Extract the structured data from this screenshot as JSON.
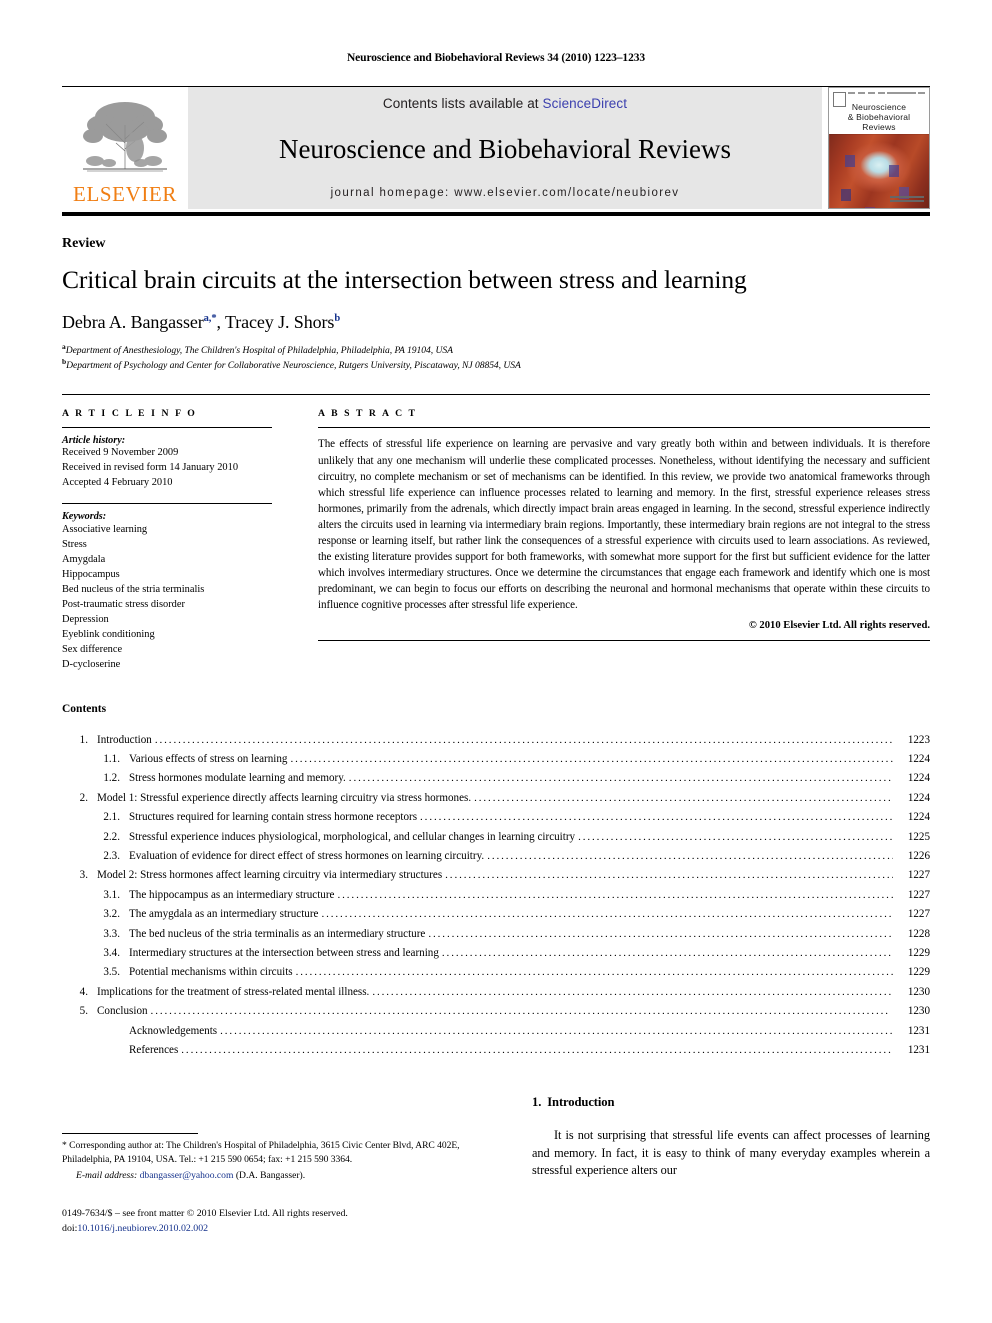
{
  "running_head": "Neuroscience and Biobehavioral Reviews 34 (2010) 1223–1233",
  "masthead": {
    "publisher_wordmark": "ELSEVIER",
    "contents_prefix": "Contents lists available at ",
    "sciencedirect": "ScienceDirect",
    "journal_title": "Neuroscience and Biobehavioral Reviews",
    "homepage": "journal homepage: www.elsevier.com/locate/neubiorev",
    "cover_title_line1": "Neuroscience",
    "cover_title_line2": "& Biobehavioral",
    "cover_title_line3": "Reviews",
    "sciencedirect_color": "#3b3fae",
    "banner_bg": "#e6e6e6",
    "elsevier_orange": "#F07E13"
  },
  "article": {
    "doctype": "Review",
    "title": "Critical brain circuits at the intersection between stress and learning",
    "authors": [
      {
        "name": "Debra A. Bangasser",
        "sup": "a,*"
      },
      {
        "name": "Tracey J. Shors",
        "sup": "b"
      }
    ],
    "affiliations": [
      {
        "mark": "a",
        "text": "Department of Anesthesiology, The Children's Hospital of Philadelphia, Philadelphia, PA 19104, USA"
      },
      {
        "mark": "b",
        "text": "Department of Psychology and Center for Collaborative Neuroscience, Rutgers University, Piscataway, NJ 08854, USA"
      }
    ]
  },
  "article_info": {
    "label": "A R T I C L E   I N F O",
    "history_head": "Article history:",
    "history": [
      "Received 9 November 2009",
      "Received in revised form 14 January 2010",
      "Accepted 4 February 2010"
    ],
    "keywords_head": "Keywords:",
    "keywords": [
      "Associative learning",
      "Stress",
      "Amygdala",
      "Hippocampus",
      "Bed nucleus of the stria terminalis",
      "Post-traumatic stress disorder",
      "Depression",
      "Eyeblink conditioning",
      "Sex difference",
      "D-cycloserine"
    ]
  },
  "abstract": {
    "label": "A B S T R A C T",
    "text": "The effects of stressful life experience on learning are pervasive and vary greatly both within and between individuals. It is therefore unlikely that any one mechanism will underlie these complicated processes. Nonetheless, without identifying the necessary and sufficient circuitry, no complete mechanism or set of mechanisms can be identified. In this review, we provide two anatomical frameworks through which stressful life experience can influence processes related to learning and memory. In the first, stressful experience releases stress hormones, primarily from the adrenals, which directly impact brain areas engaged in learning. In the second, stressful experience indirectly alters the circuits used in learning via intermediary brain regions. Importantly, these intermediary brain regions are not integral to the stress response or learning itself, but rather link the consequences of a stressful experience with circuits used to learn associations. As reviewed, the existing literature provides support for both frameworks, with somewhat more support for the first but sufficient evidence for the latter which involves intermediary structures. Once we determine the circumstances that engage each framework and identify which one is most predominant, we can begin to focus our efforts on describing the neuronal and hormonal mechanisms that operate within these circuits to influence cognitive processes after stressful life experience.",
    "copyright": "© 2010 Elsevier Ltd. All rights reserved."
  },
  "contents": {
    "heading": "Contents",
    "entries": [
      {
        "level": 1,
        "num": "1.",
        "label": "Introduction",
        "page": "1223"
      },
      {
        "level": 2,
        "num": "1.1.",
        "label": "Various effects of stress on learning",
        "page": "1224"
      },
      {
        "level": 2,
        "num": "1.2.",
        "label": "Stress hormones modulate learning and memory.",
        "page": "1224"
      },
      {
        "level": 1,
        "num": "2.",
        "label": "Model 1: Stressful experience directly affects learning circuitry via stress hormones.",
        "page": "1224"
      },
      {
        "level": 2,
        "num": "2.1.",
        "label": "Structures required for learning contain stress hormone receptors",
        "page": "1224"
      },
      {
        "level": 2,
        "num": "2.2.",
        "label": "Stressful experience induces physiological, morphological, and cellular changes in learning circuitry",
        "page": "1225"
      },
      {
        "level": 2,
        "num": "2.3.",
        "label": "Evaluation of evidence for direct effect of stress hormones on learning circuitry.",
        "page": "1226"
      },
      {
        "level": 1,
        "num": "3.",
        "label": "Model 2: Stress hormones affect learning circuitry via intermediary structures",
        "page": "1227"
      },
      {
        "level": 2,
        "num": "3.1.",
        "label": "The hippocampus as an intermediary structure",
        "page": "1227"
      },
      {
        "level": 2,
        "num": "3.2.",
        "label": "The amygdala as an intermediary structure",
        "page": "1227"
      },
      {
        "level": 2,
        "num": "3.3.",
        "label": "The bed nucleus of the stria terminalis as an intermediary structure",
        "page": "1228"
      },
      {
        "level": 2,
        "num": "3.4.",
        "label": "Intermediary structures at the intersection between stress and learning",
        "page": "1229"
      },
      {
        "level": 2,
        "num": "3.5.",
        "label": "Potential mechanisms within circuits",
        "page": "1229"
      },
      {
        "level": 1,
        "num": "4.",
        "label": "Implications for the treatment of stress-related mental illness.",
        "page": "1230"
      },
      {
        "level": 1,
        "num": "5.",
        "label": "Conclusion",
        "page": "1230"
      },
      {
        "level": 0,
        "num": "",
        "label": "Acknowledgements",
        "page": "1231"
      },
      {
        "level": 0,
        "num": "",
        "label": "References",
        "page": "1231"
      }
    ]
  },
  "footnotes": {
    "corresponding": "* Corresponding author at: The Children's Hospital of Philadelphia, 3615 Civic Center Blvd, ARC 402E, Philadelphia, PA 19104, USA. Tel.: +1 215 590 0654; fax: +1 215 590 3364.",
    "email_label": "E-mail address:",
    "email": "dbangasser@yahoo.com",
    "email_attrib": "(D.A. Bangasser).",
    "issn_line": "0149-7634/$ – see front matter © 2010 Elsevier Ltd. All rights reserved.",
    "doi_label": "doi:",
    "doi": "10.1016/j.neubiorev.2010.02.002"
  },
  "intro": {
    "number": "1.",
    "heading": "Introduction",
    "paragraph": "It is not surprising that stressful life events can affect processes of learning and memory. In fact, it is easy to think of many everyday examples wherein a stressful experience alters our"
  }
}
